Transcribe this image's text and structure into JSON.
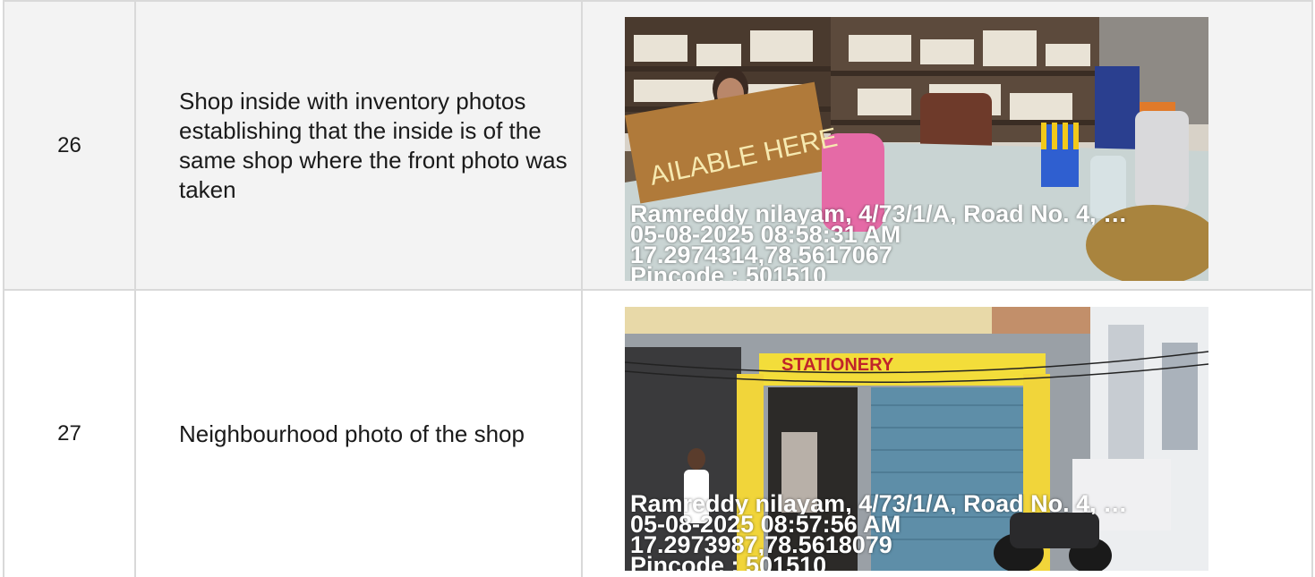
{
  "rows": [
    {
      "number": "26",
      "description": "Shop inside with inventory photos establishing that the inside is of the same shop where the front photo was taken",
      "photo": {
        "scene": "shop-interior",
        "sign_text": "AILABLE HERE",
        "overlay": {
          "address": "Ramreddy nilayam, 4/73/1/A, Road No. 4, …",
          "datetime": "05-08-2025 08:58:31 AM",
          "coordinates": "17.2974314,78.5617067",
          "pincode": "Pincode : 501510"
        }
      }
    },
    {
      "number": "27",
      "description": "Neighbourhood photo of the shop",
      "photo": {
        "scene": "shop-exterior",
        "sign_text": "STATIONERY",
        "overlay": {
          "address": "Ramreddy nilayam, 4/73/1/A, Road No. 4, …",
          "datetime": "05-08-2025 08:57:56 AM",
          "coordinates": "17.2973987,78.5618079",
          "pincode": "Pincode : 501510"
        }
      }
    }
  ]
}
